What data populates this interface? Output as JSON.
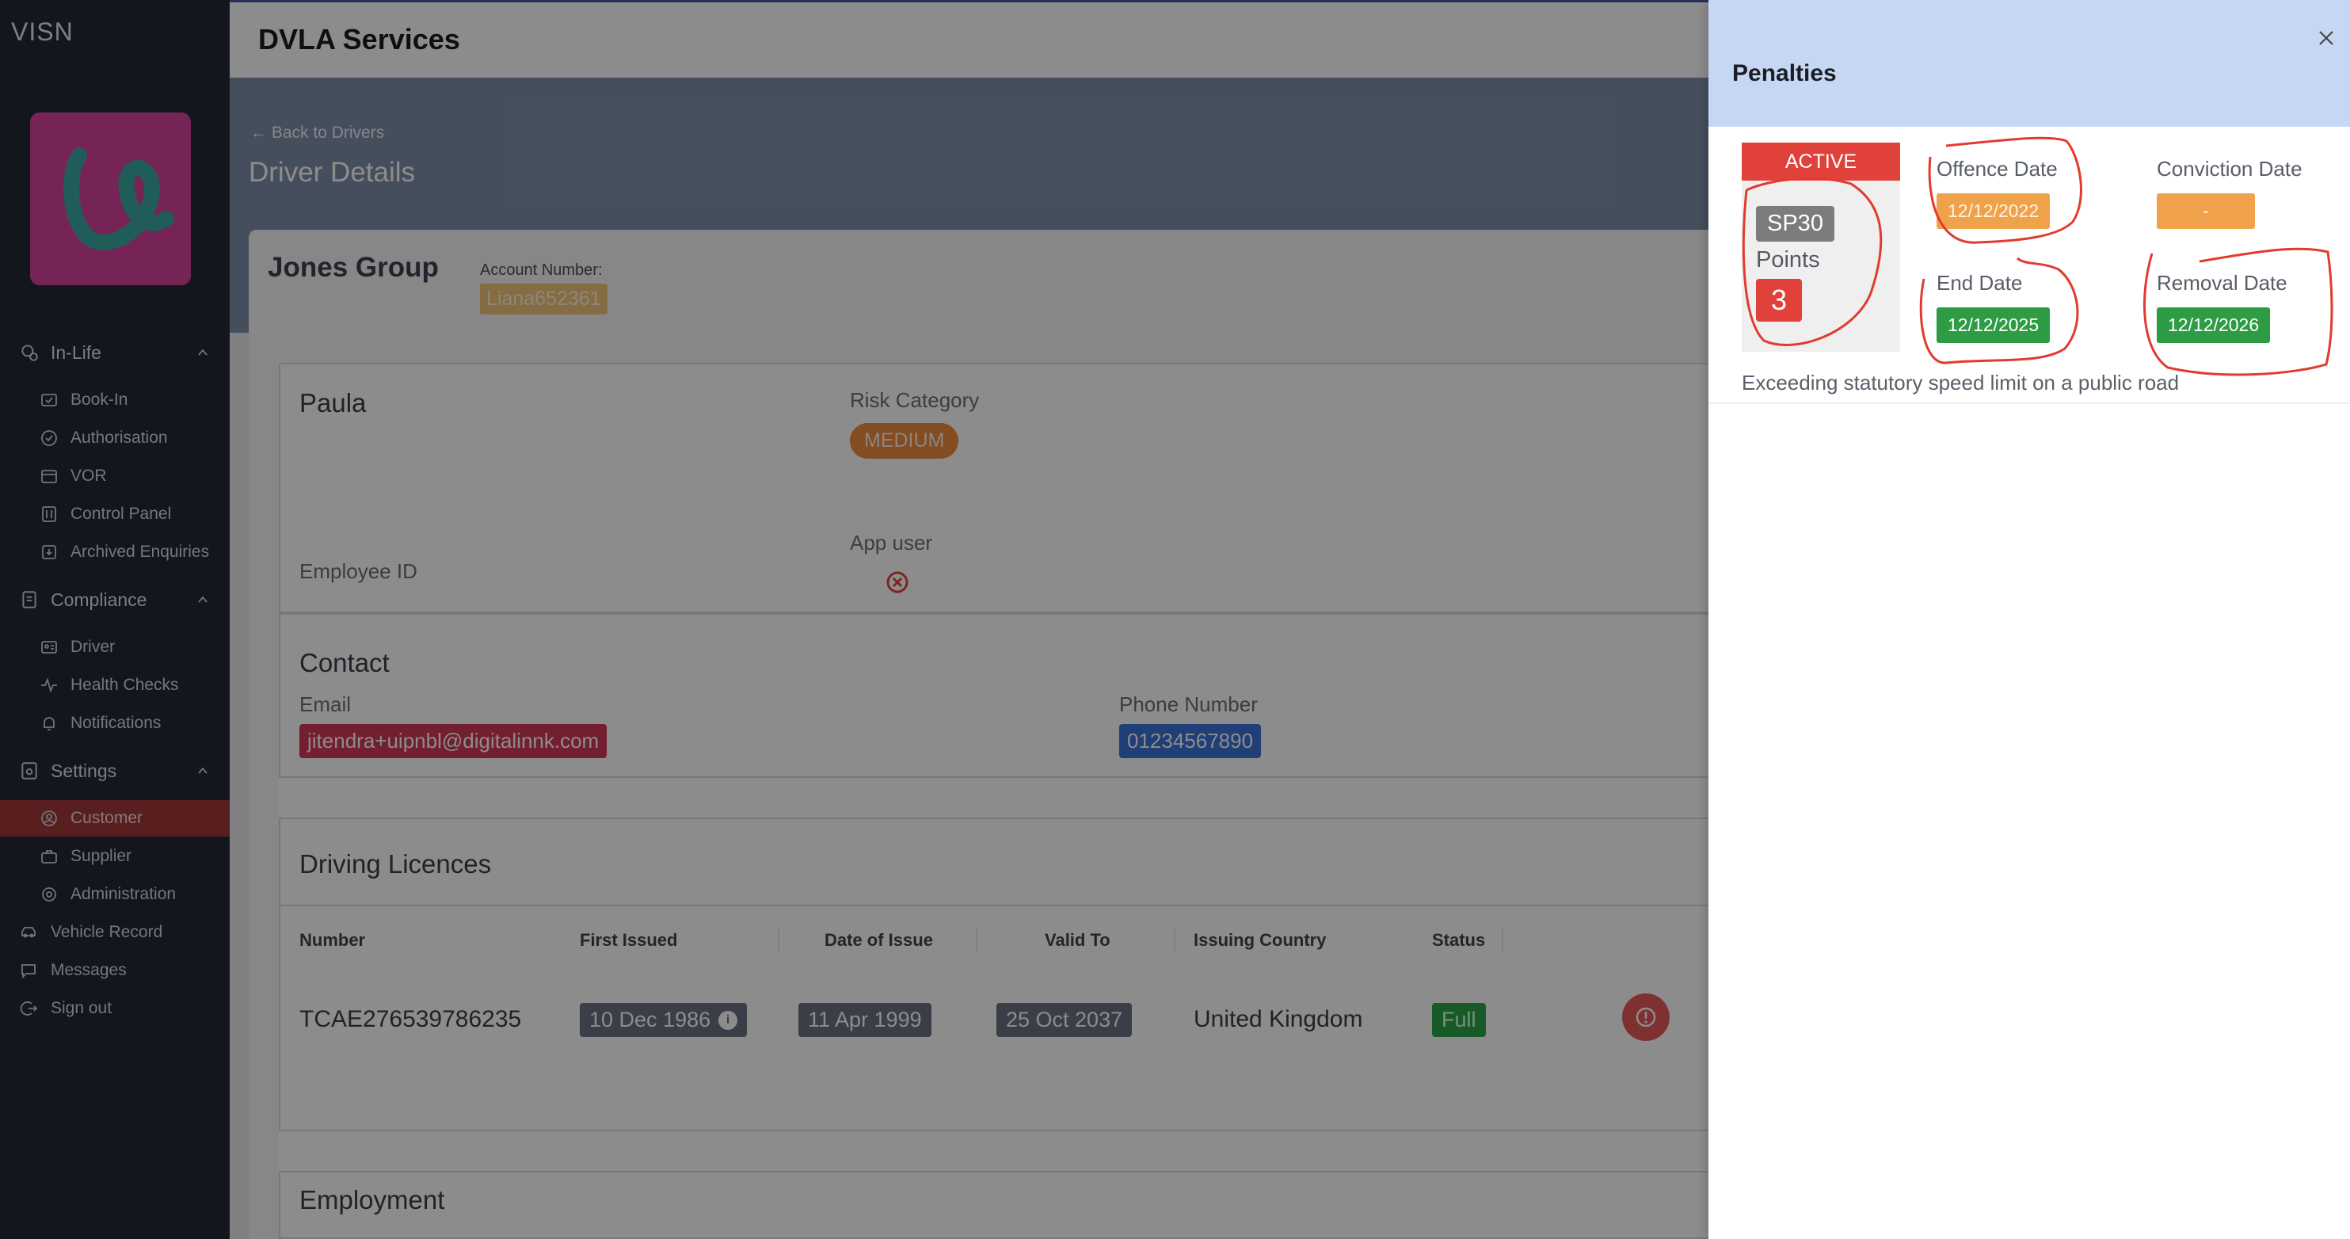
{
  "sidebar": {
    "brand": "VISN",
    "groups": [
      {
        "label": "In-Life",
        "icon": "in-life-icon"
      },
      {
        "label": "Compliance",
        "icon": "compliance-icon"
      },
      {
        "label": "Settings",
        "icon": "settings-icon"
      }
    ],
    "inlife_items": [
      {
        "label": "Book-In",
        "icon": "book-in-icon"
      },
      {
        "label": "Authorisation",
        "icon": "authorisation-icon"
      },
      {
        "label": "VOR",
        "icon": "vor-icon"
      },
      {
        "label": "Control Panel",
        "icon": "control-panel-icon"
      },
      {
        "label": "Archived Enquiries",
        "icon": "archive-icon"
      }
    ],
    "compliance_items": [
      {
        "label": "Driver",
        "icon": "driver-icon"
      },
      {
        "label": "Health Checks",
        "icon": "health-checks-icon"
      },
      {
        "label": "Notifications",
        "icon": "bell-icon"
      }
    ],
    "settings_items": [
      {
        "label": "Customer",
        "icon": "customer-icon",
        "active": true
      },
      {
        "label": "Supplier",
        "icon": "supplier-icon"
      },
      {
        "label": "Administration",
        "icon": "administration-icon"
      }
    ],
    "bottom_items": [
      {
        "label": "Vehicle Record",
        "icon": "car-icon"
      },
      {
        "label": "Messages",
        "icon": "message-icon"
      },
      {
        "label": "Sign out",
        "icon": "sign-out-icon"
      }
    ]
  },
  "header": {
    "title": "DVLA Services"
  },
  "page": {
    "back_label": "← Back to Drivers",
    "title": "Driver Details",
    "customer_name": "Jones Group",
    "account_label": "Account Number:",
    "account_value": "Liana652361"
  },
  "driver": {
    "name": "Paula",
    "risk_label": "Risk Category",
    "risk_value": "MEDIUM",
    "employee_id_label": "Employee ID",
    "app_user_label": "App user"
  },
  "contact": {
    "title": "Contact",
    "email_label": "Email",
    "email_value": "jitendra+uipnbl@digitalinnk.com",
    "phone_label": "Phone Number",
    "phone_value": "01234567890"
  },
  "licences": {
    "title": "Driving Licences",
    "headers": [
      "Number",
      "First Issued",
      "Date of Issue",
      "Valid To",
      "Issuing Country",
      "Status"
    ],
    "row": {
      "number": "TCAE276539786235",
      "first_issued": "10 Dec 1986",
      "date_of_issue": "11 Apr 1999",
      "valid_to": "25 Oct 2037",
      "country": "United Kingdom",
      "status": "Full"
    }
  },
  "employment": {
    "title": "Employment"
  },
  "drawer": {
    "title": "Penalties",
    "penalty": {
      "status": "ACTIVE",
      "code": "SP30",
      "points_label": "Points",
      "points": "3",
      "offence_date_label": "Offence Date",
      "offence_date": "12/12/2022",
      "conviction_date_label": "Conviction Date",
      "conviction_date": "-",
      "end_date_label": "End Date",
      "end_date": "12/12/2025",
      "removal_date_label": "Removal Date",
      "removal_date": "12/12/2026",
      "description": "Exceeding statutory speed limit on a public road"
    }
  },
  "colors": {
    "sidebar_bg": "#232a36",
    "active_item": "#a33a3a",
    "drawer_header": "#c6d7f4",
    "active_status": "#e1413b",
    "green_chip": "#2e9c44",
    "orange_chip": "#f0a24b",
    "annotation": "#e23b2e"
  }
}
